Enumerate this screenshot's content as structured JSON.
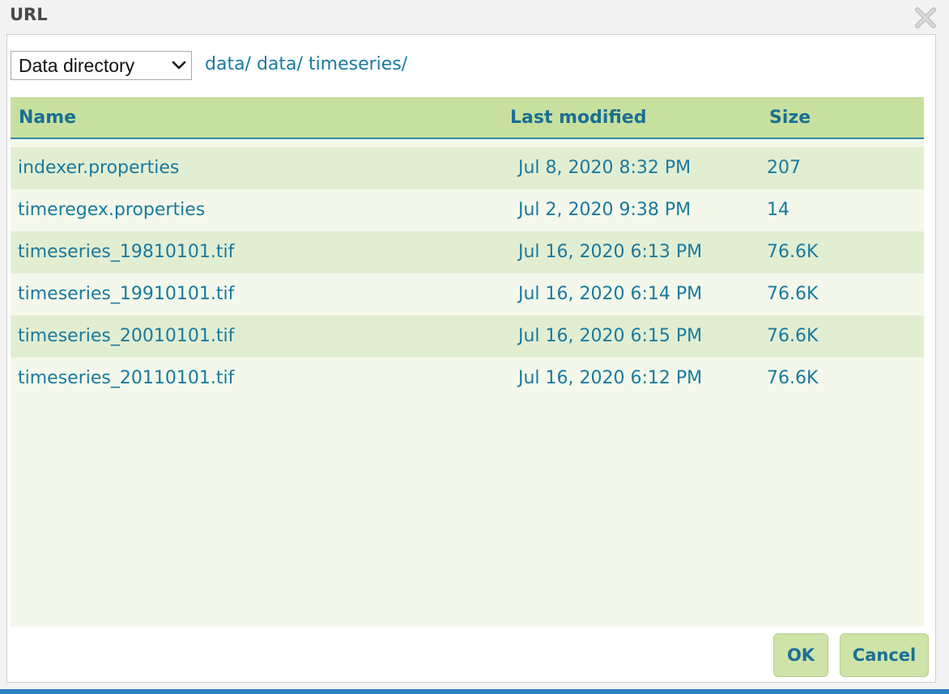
{
  "dialog": {
    "title": "URL",
    "close_icon": "close-icon"
  },
  "source_select": {
    "selected": "Data directory",
    "chevron_icon": "chevron-down-icon"
  },
  "breadcrumb": [
    "data/",
    "data/",
    "timeseries/"
  ],
  "table": {
    "columns": {
      "name": "Name",
      "modified": "Last modified",
      "size": "Size"
    },
    "rows": [
      {
        "name": "indexer.properties",
        "modified": "Jul 8, 2020 8:32 PM",
        "size": "207"
      },
      {
        "name": "timeregex.properties",
        "modified": "Jul 2, 2020 9:38 PM",
        "size": "14"
      },
      {
        "name": "timeseries_19810101.tif",
        "modified": "Jul 16, 2020 6:13 PM",
        "size": "76.6K"
      },
      {
        "name": "timeseries_19910101.tif",
        "modified": "Jul 16, 2020 6:14 PM",
        "size": "76.6K"
      },
      {
        "name": "timeseries_20010101.tif",
        "modified": "Jul 16, 2020 6:15 PM",
        "size": "76.6K"
      },
      {
        "name": "timeseries_20110101.tif",
        "modified": "Jul 16, 2020 6:12 PM",
        "size": "76.6K"
      }
    ]
  },
  "buttons": {
    "ok": "OK",
    "cancel": "Cancel"
  },
  "colors": {
    "header_bg": "#c8e09f",
    "link_text": "#1a7a9e",
    "row_odd": "#e2eed2",
    "row_even": "#f3f8eb",
    "button_bg": "#cde3a8"
  }
}
